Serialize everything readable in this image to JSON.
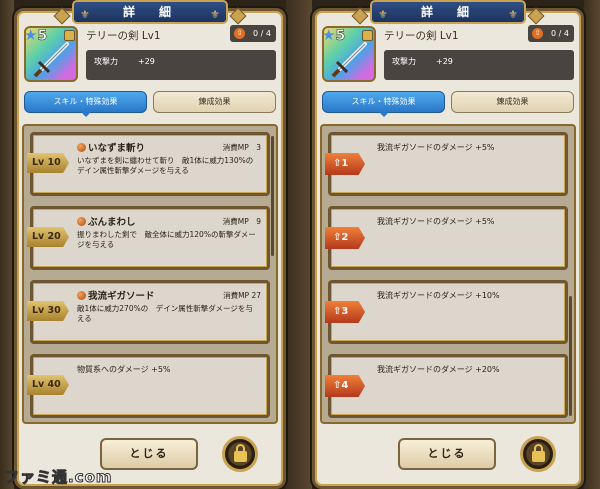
{
  "title": "詳　細",
  "weapon": {
    "stars": "5",
    "name": "テリーの剣 Lv1",
    "upgrade": "0 / 4",
    "stat_label": "攻撃力",
    "stat_value": "+29"
  },
  "tabs": [
    "スキル・特殊効果",
    "錬成効果"
  ],
  "skills": [
    {
      "lv": "Lv 10",
      "name": "いなずま斬り",
      "mp": "消費MP　3",
      "desc": "いなずまを剣に纏わせて斬り　敵1体に威力130%のデイン属性斬撃ダメージを与える"
    },
    {
      "lv": "Lv 20",
      "name": "ぶんまわし",
      "mp": "消費MP　9",
      "desc": "振りまわした剣で　敵全体に威力120%の斬撃ダメージを与える"
    },
    {
      "lv": "Lv 30",
      "name": "我流ギガソード",
      "mp": "消費MP 27",
      "desc": "敵1体に威力270%の　デイン属性斬撃ダメージを与える"
    },
    {
      "lv": "Lv 40",
      "desc": "物質系へのダメージ +5%"
    }
  ],
  "refine": [
    {
      "step": "1",
      "desc": "我流ギガソードのダメージ +5%"
    },
    {
      "step": "2",
      "desc": "我流ギガソードのダメージ +5%"
    },
    {
      "step": "3",
      "desc": "我流ギガソードのダメージ +10%"
    },
    {
      "step": "4",
      "desc": "我流ギガソードのダメージ +20%"
    }
  ],
  "close_label": "とじる",
  "watermark": "ファミ通.com",
  "colors": {
    "active_tab": "#2a78c8",
    "frame_gold": "#c9a34f",
    "refine_arrow": "#b3391c"
  }
}
